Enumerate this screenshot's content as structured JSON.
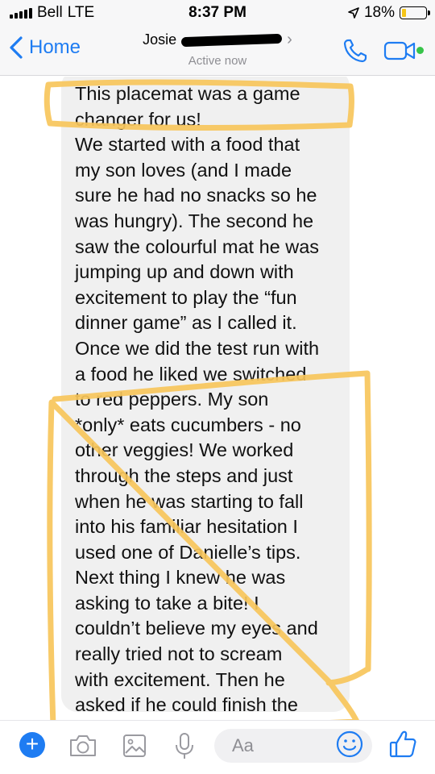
{
  "status_bar": {
    "carrier": "Bell",
    "network": "LTE",
    "time": "8:37 PM",
    "battery": "18%",
    "battery_level": 0.18
  },
  "header": {
    "back_label": "Home",
    "contact_name_visible": "Josie",
    "contact_status": "Active now",
    "chevron": "›",
    "icons": [
      "chevron-left-icon",
      "phone-icon",
      "video-camera-icon"
    ]
  },
  "message": {
    "lines": [
      "This placemat was a game",
      "changer for us!",
      "We started with a food that",
      "my son loves (and I made",
      "sure he had no snacks so he",
      "was hungry). The second he",
      "saw the colourful mat he was",
      "jumping up and down with",
      "excitement to play the “fun",
      "dinner game” as I called it.",
      "Once we did the test run with",
      "a food he liked we switched",
      "to red peppers. My son",
      "*only* eats cucumbers - no",
      "other veggies! We worked",
      "through the steps and just",
      "when he was starting to fall",
      "into his familiar hesitation I",
      "used one of Danielle’s tips.",
      "Next thing I knew he was",
      "asking to take a bite! I",
      "couldn’t believe my eyes and",
      "really tried not to scream",
      "with excitement. Then he",
      "asked if he could finish the"
    ]
  },
  "composer": {
    "plus_label": "+",
    "input_placeholder": "Aa",
    "icons": [
      "plus-icon",
      "camera-icon",
      "image-icon",
      "microphone-icon",
      "emoji-icon",
      "thumbs-up-icon"
    ]
  },
  "colors": {
    "accent": "#1e7cf2",
    "bubble": "#f0f0f0",
    "highlight": "#f7c55b",
    "online": "#37c44a"
  }
}
